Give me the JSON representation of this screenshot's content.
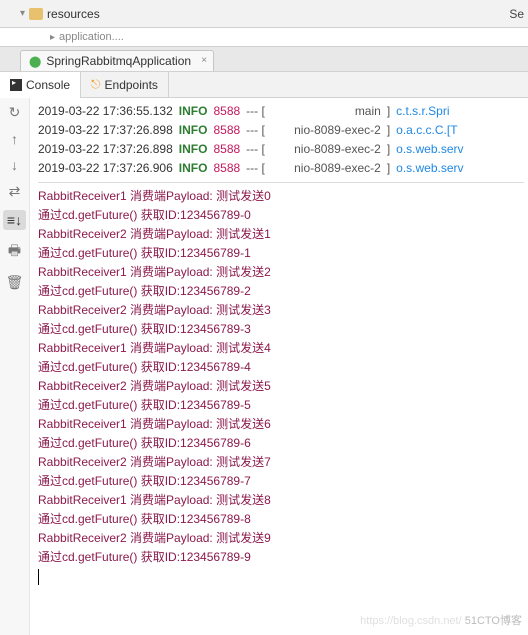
{
  "header": {
    "folder": "resources",
    "subfile": "application....",
    "se": "Se"
  },
  "tab": {
    "label": "SpringRabbitmqApplication"
  },
  "tools": {
    "console": "Console",
    "endpoints": "Endpoints"
  },
  "logTop": [
    {
      "ts": "2019-03-22 17:36:55.132",
      "lvl": "INFO",
      "pid": "8588",
      "thread": "main",
      "logger": "c.t.s.r.Spri"
    },
    {
      "ts": "2019-03-22 17:37:26.898",
      "lvl": "INFO",
      "pid": "8588",
      "thread": "nio-8089-exec-2",
      "logger": "o.a.c.c.C.[T"
    },
    {
      "ts": "2019-03-22 17:37:26.898",
      "lvl": "INFO",
      "pid": "8588",
      "thread": "nio-8089-exec-2",
      "logger": "o.s.web.serv"
    },
    {
      "ts": "2019-03-22 17:37:26.906",
      "lvl": "INFO",
      "pid": "8588",
      "thread": "nio-8089-exec-2",
      "logger": "o.s.web.serv"
    }
  ],
  "messages": [
    "RabbitReceiver1 消费端Payload: 测试发送0",
    "通过cd.getFuture() 获取ID:123456789-0",
    "RabbitReceiver2 消费端Payload: 测试发送1",
    "通过cd.getFuture() 获取ID:123456789-1",
    "RabbitReceiver1 消费端Payload: 测试发送2",
    "通过cd.getFuture() 获取ID:123456789-2",
    "RabbitReceiver2 消费端Payload: 测试发送3",
    "通过cd.getFuture() 获取ID:123456789-3",
    "RabbitReceiver1 消费端Payload: 测试发送4",
    "通过cd.getFuture() 获取ID:123456789-4",
    "RabbitReceiver2 消费端Payload: 测试发送5",
    "通过cd.getFuture() 获取ID:123456789-5",
    "RabbitReceiver1 消费端Payload: 测试发送6",
    "通过cd.getFuture() 获取ID:123456789-6",
    "RabbitReceiver2 消费端Payload: 测试发送7",
    "通过cd.getFuture() 获取ID:123456789-7",
    "RabbitReceiver1 消费端Payload: 测试发送8",
    "通过cd.getFuture() 获取ID:123456789-8",
    "RabbitReceiver2 消费端Payload: 测试发送9",
    "通过cd.getFuture() 获取ID:123456789-9"
  ],
  "watermark": {
    "faint": "https://blog.csdn.net/",
    "main": "51CTO博客"
  }
}
